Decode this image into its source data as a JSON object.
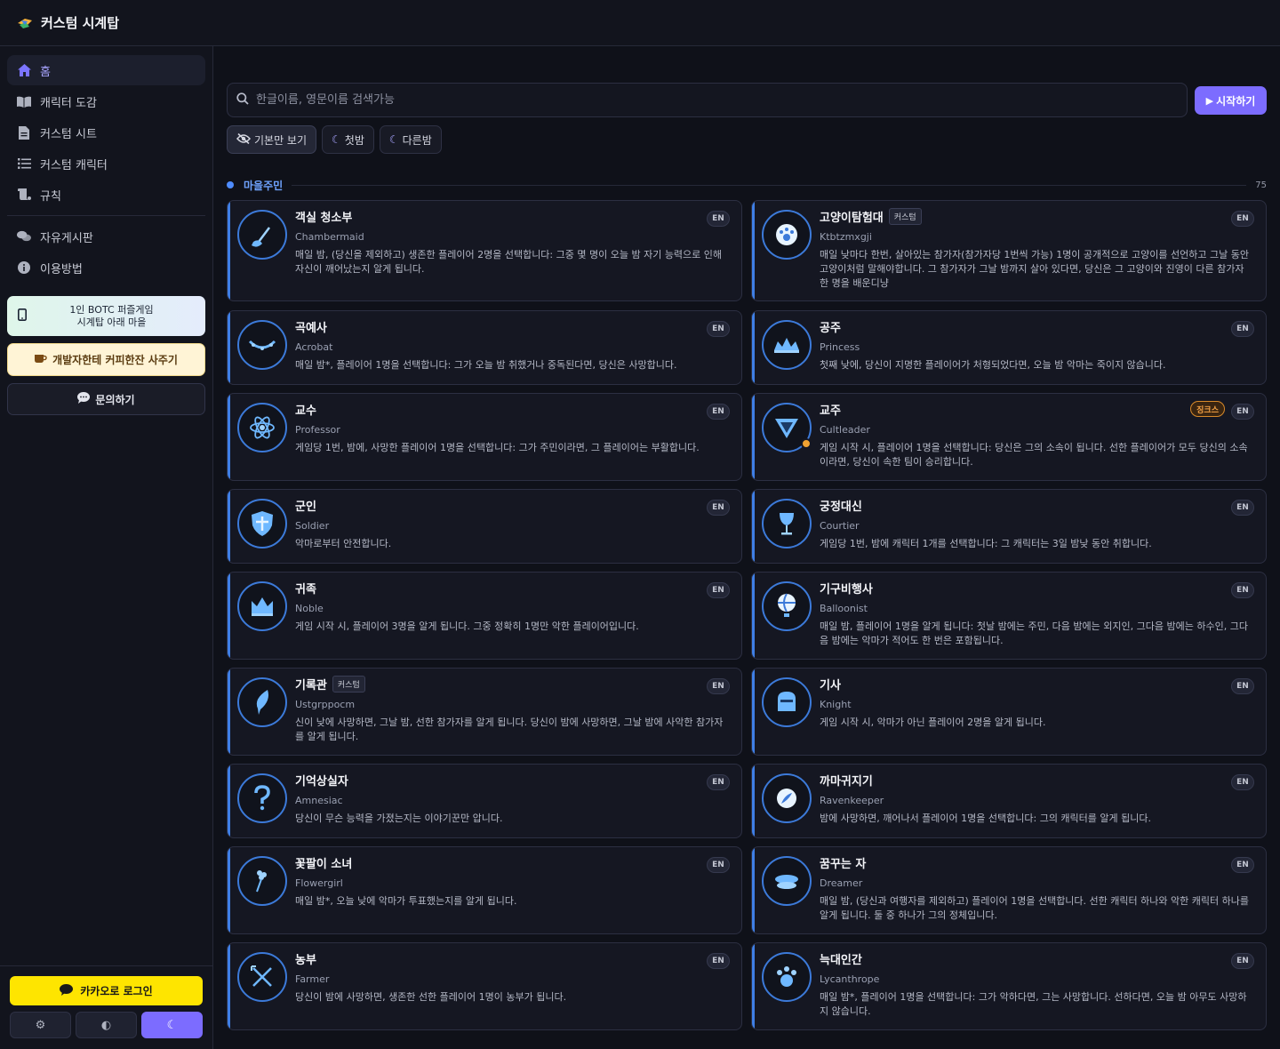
{
  "app": {
    "title": "커스텀 시계탑"
  },
  "sidebar": {
    "nav": [
      {
        "label": "홈",
        "icon": "home-icon"
      },
      {
        "label": "캐릭터 도감",
        "icon": "book-icon"
      },
      {
        "label": "커스텀 시트",
        "icon": "document-icon"
      },
      {
        "label": "커스텀 캐릭터",
        "icon": "list-icon"
      },
      {
        "label": "규칙",
        "icon": "scroll-icon"
      },
      {
        "label": "자유게시판",
        "icon": "chat-icon"
      },
      {
        "label": "이용방법",
        "icon": "info-icon"
      }
    ],
    "promo_line1": "1인 BOTC 퍼즐게임",
    "promo_line2": "시계탑 아래 마을",
    "coffee_label": "개발자한테 커피한잔 사주기",
    "inquiry_label": "문의하기",
    "kakao_label": "카카오로 로그인"
  },
  "search": {
    "placeholder": "한글이름, 영문이름 검색가능"
  },
  "start_label": "시작하기",
  "filters": [
    "기본만 보기",
    "첫밤",
    "다른밤"
  ],
  "section": {
    "label": "마을주민",
    "count": "75"
  },
  "cards": [
    {
      "name": "객실 청소부",
      "eng": "Chambermaid",
      "desc": "매일 밤, (당신을 제외하고) 생존한 플레이어 2명을 선택합니다: 그중 몇 명이 오늘 밤 자기 능력으로 인해 자신이 깨어났는지 알게 됩니다.",
      "lang": "EN",
      "icon": "mop-icon"
    },
    {
      "name": "고양이탐험대",
      "tag": "커스텀",
      "eng": "Ktbtzmxgji",
      "desc": "매일 낮마다 한번, 살아있는 참가자(참가자당 1번씩 가능) 1명이 공개적으로 고양이를 선언하고 그날 동안 고양이처럼 말해야합니다. 그 참가자가 그날 밤까지 살아 있다면, 당신은 그 고양이와 진영이 다른 참가자 한 명을 배운디냥",
      "lang": "EN",
      "icon": "paw-icon"
    },
    {
      "name": "곡예사",
      "eng": "Acrobat",
      "desc": "매일 밤*, 플레이어 1명을 선택합니다: 그가 오늘 밤 취했거나 중독된다면, 당신은 사망합니다.",
      "lang": "EN",
      "icon": "garland-icon"
    },
    {
      "name": "공주",
      "eng": "Princess",
      "desc": "첫째 낮에, 당신이 지명한 플레이어가 처형되었다면, 오늘 밤 악마는 죽이지 않습니다.",
      "lang": "EN",
      "icon": "tiara-icon"
    },
    {
      "name": "교수",
      "eng": "Professor",
      "desc": "게임당 1번, 밤에, 사망한 플레이어 1명을 선택합니다: 그가 주민이라면, 그 플레이어는 부활합니다.",
      "lang": "EN",
      "icon": "atom-icon"
    },
    {
      "name": "교주",
      "eng": "Cultleader",
      "desc": "게임 시작 시, 플레이어 1명을 선택합니다: 당신은 그의 소속이 됩니다. 선한 플레이어가 모두 당신의 소속이라면, 당신이 속한 팀이 승리합니다.",
      "lang": "EN",
      "jinx": "징크스",
      "icon": "triangle-icon"
    },
    {
      "name": "군인",
      "eng": "Soldier",
      "desc": "악마로부터 안전합니다.",
      "lang": "EN",
      "icon": "shield-icon"
    },
    {
      "name": "궁정대신",
      "eng": "Courtier",
      "desc": "게임당 1번, 밤에 캐릭터 1개를 선택합니다: 그 캐릭터는 3일 밤낮 동안 취합니다.",
      "lang": "EN",
      "icon": "goblet-icon"
    },
    {
      "name": "귀족",
      "eng": "Noble",
      "desc": "게임 시작 시, 플레이어 3명을 알게 됩니다. 그중 정확히 1명만 악한 플레이어입니다.",
      "lang": "EN",
      "icon": "crown-icon"
    },
    {
      "name": "기구비행사",
      "eng": "Balloonist",
      "desc": "매일 밤, 플레이어 1명을 알게 됩니다: 첫날 밤에는 주민, 다음 밤에는 외지인, 그다음 밤에는 하수인, 그다음 밤에는 악마가 적어도 한 번은 포함됩니다.",
      "lang": "EN",
      "icon": "balloon-icon"
    },
    {
      "name": "기록관",
      "tag": "커스텀",
      "eng": "Ustgrppocm",
      "desc": "신이 낮에 사망하면, 그날 밤, 선한 참가자를 알게 됩니다. 당신이 밤에 사망하면, 그날 밤에 사악한 참가자를 알게 됩니다.",
      "lang": "EN",
      "icon": "quill-icon"
    },
    {
      "name": "기사",
      "eng": "Knight",
      "desc": "게임 시작 시, 악마가 아닌 플레이어 2명을 알게 됩니다.",
      "lang": "EN",
      "icon": "helmet-icon"
    },
    {
      "name": "기억상실자",
      "eng": "Amnesiac",
      "desc": "당신이 무슨 능력을 가졌는지는 이야기꾼만 압니다.",
      "lang": "EN",
      "icon": "question-icon"
    },
    {
      "name": "까마귀지기",
      "eng": "Ravenkeeper",
      "desc": "밤에 사망하면, 깨어나서 플레이어 1명을 선택합니다: 그의 캐릭터를 알게 됩니다.",
      "lang": "EN",
      "icon": "raven-icon"
    },
    {
      "name": "꽃팔이 소녀",
      "eng": "Flowergirl",
      "desc": "매일 밤*, 오늘 낮에 악마가 투표했는지를 알게 됩니다.",
      "lang": "EN",
      "icon": "flower-icon"
    },
    {
      "name": "꿈꾸는 자",
      "eng": "Dreamer",
      "desc": "매일 밤, (당신과 여행자를 제외하고) 플레이어 1명을 선택합니다. 선한 캐릭터 하나와 악한 캐릭터 하나를 알게 됩니다. 둘 중 하나가 그의 정체입니다.",
      "lang": "EN",
      "icon": "cloud-icon"
    },
    {
      "name": "농부",
      "eng": "Farmer",
      "desc": "당신이 밤에 사망하면, 생존한 선한 플레이어 1명이 농부가 됩니다.",
      "lang": "EN",
      "icon": "pitchfork-icon"
    },
    {
      "name": "늑대인간",
      "eng": "Lycanthrope",
      "desc": "매일 밤*, 플레이어 1명을 선택합니다: 그가 악하다면, 그는 사망합니다. 선하다면, 오늘 밤 아무도 사망하지 않습니다.",
      "lang": "EN",
      "icon": "wolf-paw-icon"
    }
  ],
  "colors": {
    "accent": "#7c6cff",
    "card_border": "#2c2f42",
    "icon_ring": "#3c7ad9",
    "kakao": "#fee500"
  }
}
